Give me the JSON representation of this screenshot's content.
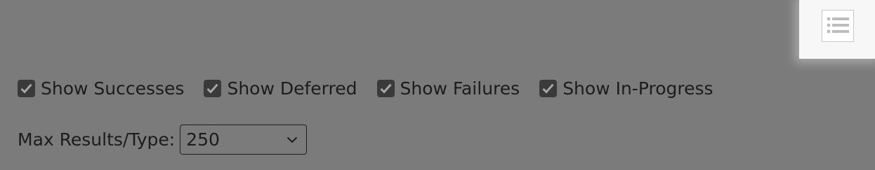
{
  "toolbar": {
    "toc_icon": "list-icon"
  },
  "filters": [
    {
      "label": "Show Successes",
      "checked": true
    },
    {
      "label": "Show Deferred",
      "checked": true
    },
    {
      "label": "Show Failures",
      "checked": true
    },
    {
      "label": "Show In-Progress",
      "checked": true
    }
  ],
  "max_results": {
    "label": "Max Results/Type:",
    "selected": "250"
  },
  "colors": {
    "background": "#7b7b7b",
    "text": "#1c1c1c",
    "checkbox": "#3a3a3a",
    "panel": "#f7f7f7"
  }
}
